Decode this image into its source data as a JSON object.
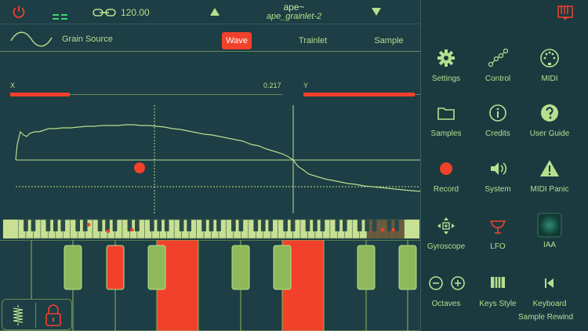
{
  "topbar": {
    "bpm": "120.00",
    "title": "ape~",
    "subtitle": "ape_grainlet-2"
  },
  "tabs": {
    "source_label": "Grain Source",
    "items": [
      "Wave",
      "Trainlet",
      "Sample"
    ],
    "active": "Wave"
  },
  "sliders": {
    "x_label": "X",
    "x_value": "0.217",
    "y_label": "Y"
  },
  "panel": {
    "items": [
      {
        "label": "Settings",
        "icon": "gear-icon"
      },
      {
        "label": "Control",
        "icon": "control-nodes-icon"
      },
      {
        "label": "MIDI",
        "icon": "midi-port-icon"
      },
      {
        "label": "Samples",
        "icon": "folder-icon"
      },
      {
        "label": "Credits",
        "icon": "info-icon"
      },
      {
        "label": "User Guide",
        "icon": "help-icon"
      },
      {
        "label": "Record",
        "icon": "record-icon"
      },
      {
        "label": "System",
        "icon": "speaker-icon"
      },
      {
        "label": "MIDI Panic",
        "icon": "warning-icon"
      },
      {
        "label": "Gyroscope",
        "icon": "gyroscope-icon"
      },
      {
        "label": "LFO",
        "icon": "lfo-icon"
      },
      {
        "label": "IAA",
        "icon": "iaa-icon"
      },
      {
        "label": "Octaves",
        "icon": "octave-minus-plus-icon"
      },
      {
        "label": "Keys Style",
        "icon": "keys-style-icon"
      },
      {
        "label": "Keyboard",
        "icon": "keyboard-icon"
      },
      {
        "label": "Sample Rewind",
        "icon": "sample-rewind-icon"
      }
    ]
  },
  "colors": {
    "background": "#1c3e44",
    "accent_red": "#f2412b",
    "accent_green": "#b7df8e",
    "key_green": "#8fb85a"
  }
}
